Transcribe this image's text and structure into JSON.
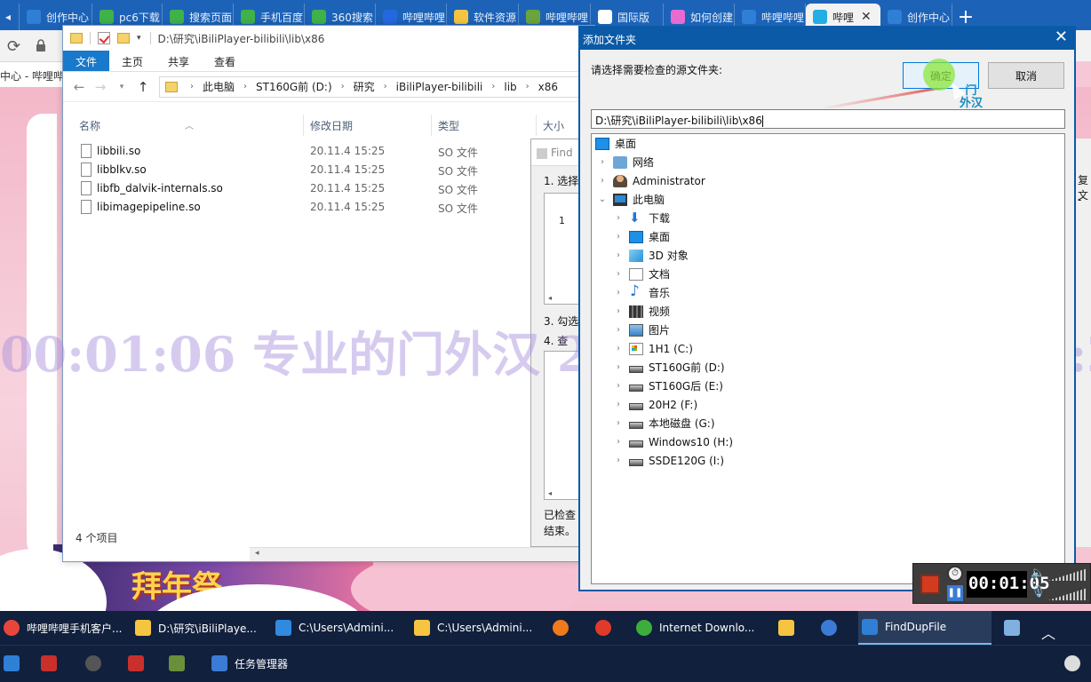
{
  "browser": {
    "tabs": [
      {
        "label": "创作中心",
        "color": "#2f7fd6"
      },
      {
        "label": "pc6下载",
        "color": "#3fb24a"
      },
      {
        "label": "搜索页面",
        "color": "#3fb24a"
      },
      {
        "label": "手机百度",
        "color": "#3fb24a"
      },
      {
        "label": "360搜索",
        "color": "#3fb24a"
      },
      {
        "label": "哔哩哔哩",
        "color": "#2468e0"
      },
      {
        "label": "软件资源",
        "color": "#f5c542"
      },
      {
        "label": "哔哩哔哩",
        "color": "#6ca33c"
      },
      {
        "label": "国际版",
        "color": "#ffffff"
      },
      {
        "label": "如何创建",
        "color": "#e86bd1"
      },
      {
        "label": "哔哩哔哩",
        "color": "#2f7fd6"
      },
      {
        "label": "哔哩",
        "color": "#23ade5",
        "active": true
      },
      {
        "label": "创作中心",
        "color": "#2f7fd6"
      }
    ],
    "bookmark_text": "中心 - 哔哩哔"
  },
  "watermark": "00:01:06 专业的门外汉 2021年3月25日 9:30:2",
  "background_banner": "拜年祭",
  "explorer": {
    "title": "D:\\研究\\iBiliPlayer-bilibili\\lib\\x86",
    "ribbon_tabs": [
      "文件",
      "主页",
      "共享",
      "查看"
    ],
    "breadcrumb": [
      "此电脑",
      "ST160G前 (D:)",
      "研究",
      "iBiliPlayer-bilibili",
      "lib",
      "x86"
    ],
    "columns": {
      "name": "名称",
      "date": "修改日期",
      "type": "类型",
      "size": "大小"
    },
    "files": [
      {
        "name": "libbili.so",
        "date": "20.11.4 15:25",
        "type": "SO 文件"
      },
      {
        "name": "libblkv.so",
        "date": "20.11.4 15:25",
        "type": "SO 文件"
      },
      {
        "name": "libfb_dalvik-internals.so",
        "date": "20.11.4 15:25",
        "type": "SO 文件"
      },
      {
        "name": "libimagepipeline.so",
        "date": "20.11.4 15:25",
        "type": "SO 文件"
      }
    ],
    "status": "4 个项目"
  },
  "finddup": {
    "title": "Find",
    "step1": "1. 选择",
    "row_number": "1",
    "step3": "3. 勾选",
    "step4": "4. 查",
    "checked": "已检查",
    "end": "结束。"
  },
  "right_fragment": {
    "text1": "复文",
    "text2": "-"
  },
  "dialog": {
    "title": "添加文件夹",
    "prompt": "请选择需要检查的源文件夹:",
    "ok_label": "确定",
    "cancel_label": "取消",
    "cursor_caption_line1": "门",
    "cursor_caption_line2": "外汉",
    "path_value": "D:\\研究\\iBiliPlayer-bilibili\\lib\\x86",
    "tree": [
      {
        "label": "桌面",
        "level": 0,
        "icon": "desktop-icon",
        "chevron": ""
      },
      {
        "label": "网络",
        "level": 1,
        "icon": "network-icon",
        "chevron": ">"
      },
      {
        "label": "Administrator",
        "level": 1,
        "icon": "user-icon",
        "chevron": ">"
      },
      {
        "label": "此电脑",
        "level": 1,
        "icon": "pc-icon",
        "chevron": "v"
      },
      {
        "label": "下载",
        "level": 2,
        "icon": "download-icon",
        "chevron": ">"
      },
      {
        "label": "桌面",
        "level": 2,
        "icon": "desktop-icon",
        "chevron": ">"
      },
      {
        "label": "3D 对象",
        "level": 2,
        "icon": "3d-objects-icon",
        "chevron": ">"
      },
      {
        "label": "文档",
        "level": 2,
        "icon": "documents-icon",
        "chevron": ">"
      },
      {
        "label": "音乐",
        "level": 2,
        "icon": "music-icon",
        "chevron": ">"
      },
      {
        "label": "视频",
        "level": 2,
        "icon": "video-icon",
        "chevron": ">"
      },
      {
        "label": "图片",
        "level": 2,
        "icon": "pictures-icon",
        "chevron": ">"
      },
      {
        "label": "1H1 (C:)",
        "level": 2,
        "icon": "system-drive-icon",
        "chevron": ">"
      },
      {
        "label": "ST160G前 (D:)",
        "level": 2,
        "icon": "drive-icon",
        "chevron": ">"
      },
      {
        "label": "ST160G后 (E:)",
        "level": 2,
        "icon": "drive-icon",
        "chevron": ">"
      },
      {
        "label": "20H2 (F:)",
        "level": 2,
        "icon": "drive-icon",
        "chevron": ">"
      },
      {
        "label": "本地磁盘 (G:)",
        "level": 2,
        "icon": "drive-icon",
        "chevron": ">"
      },
      {
        "label": "Windows10 (H:)",
        "level": 2,
        "icon": "drive-icon",
        "chevron": ">"
      },
      {
        "label": "SSDE120G (I:)",
        "level": 2,
        "icon": "drive-icon",
        "chevron": ">"
      }
    ]
  },
  "recorder": {
    "time": "00:01:05"
  },
  "taskbar": {
    "row1": [
      {
        "label": "哔哩哔哩手机客户...",
        "color": "#e9463b"
      },
      {
        "label": "D:\\研究\\iBiliPlaye...",
        "color": "#f5c542"
      },
      {
        "label": "C:\\Users\\Admini...",
        "color": "#2f8ae0"
      },
      {
        "label": "C:\\Users\\Admini...",
        "color": "#f5c542"
      },
      {
        "label": "",
        "color": "#f07a1c"
      },
      {
        "label": "",
        "color": "#e23a2a"
      },
      {
        "label": "Internet Downlo...",
        "color": "#3cae3c"
      },
      {
        "label": "",
        "color": "#f5c542"
      },
      {
        "label": "",
        "color": "#3a7bd5"
      },
      {
        "label": "FindDupFile",
        "color": "#2f7fd6"
      },
      {
        "label": "",
        "color": "#7fb0e0"
      }
    ],
    "row2": [
      {
        "label": "",
        "color": "#2f7fd6"
      },
      {
        "label": "",
        "color": "#c9302c"
      },
      {
        "label": "",
        "color": "#555555"
      },
      {
        "label": "",
        "color": "#c9302c"
      },
      {
        "label": "",
        "color": "#6a8f3a"
      },
      {
        "label": "任务管理器",
        "color": "#3a7bd5"
      }
    ]
  }
}
